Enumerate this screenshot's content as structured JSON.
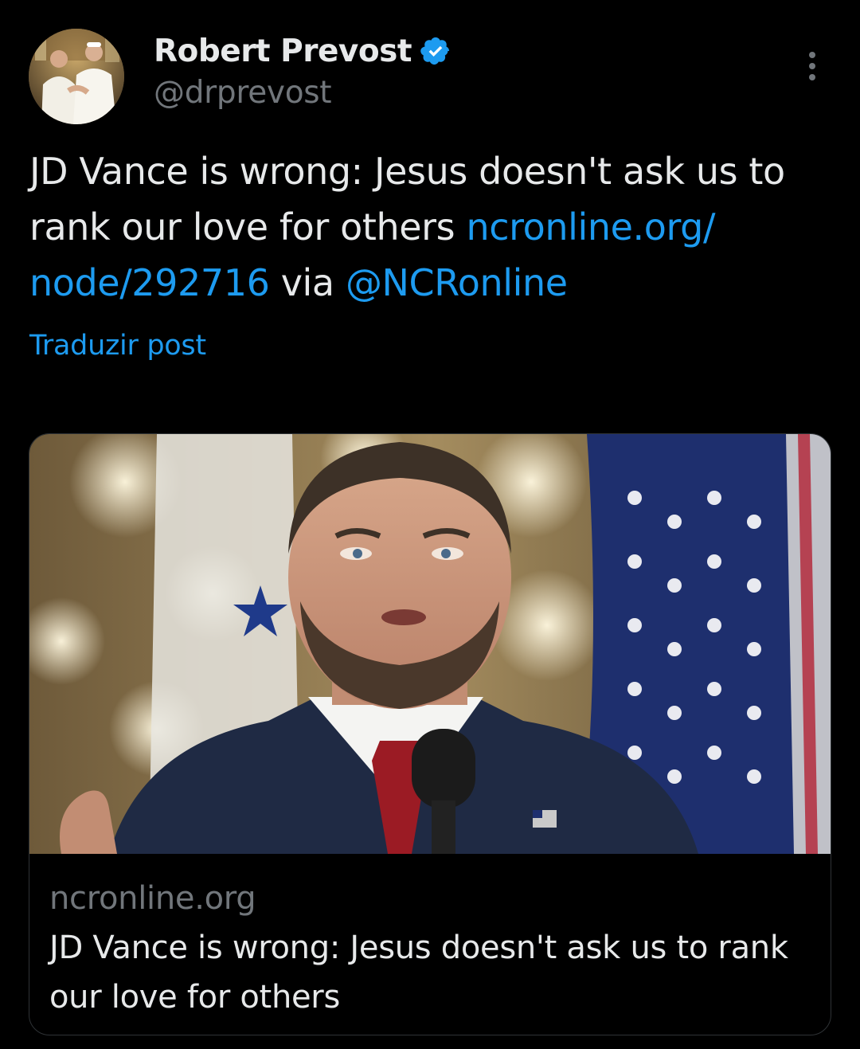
{
  "author": {
    "display_name": "Robert Prevost",
    "handle": "@drprevost",
    "verified": true,
    "avatar_icon": "avatar-photo"
  },
  "post": {
    "text_before": "JD Vance is wrong: Jesus doesn't ask us to rank our love for others ",
    "link_text": "ncronline.org/ node/292716",
    "text_middle": " via ",
    "mention": "@NCRonline",
    "translate_label": "Traduzir post"
  },
  "card": {
    "domain": "ncronline.org",
    "title": "JD Vance is wrong: Jesus doesn't ask us to rank our love for others",
    "image_icon": "article-photo"
  },
  "colors": {
    "background": "#000000",
    "text": "#e7e9ea",
    "secondary": "#71767b",
    "accent": "#1d9bf0",
    "border": "#2f3336"
  },
  "icons": {
    "verified": "verified-badge-icon",
    "more": "more-options-icon"
  }
}
